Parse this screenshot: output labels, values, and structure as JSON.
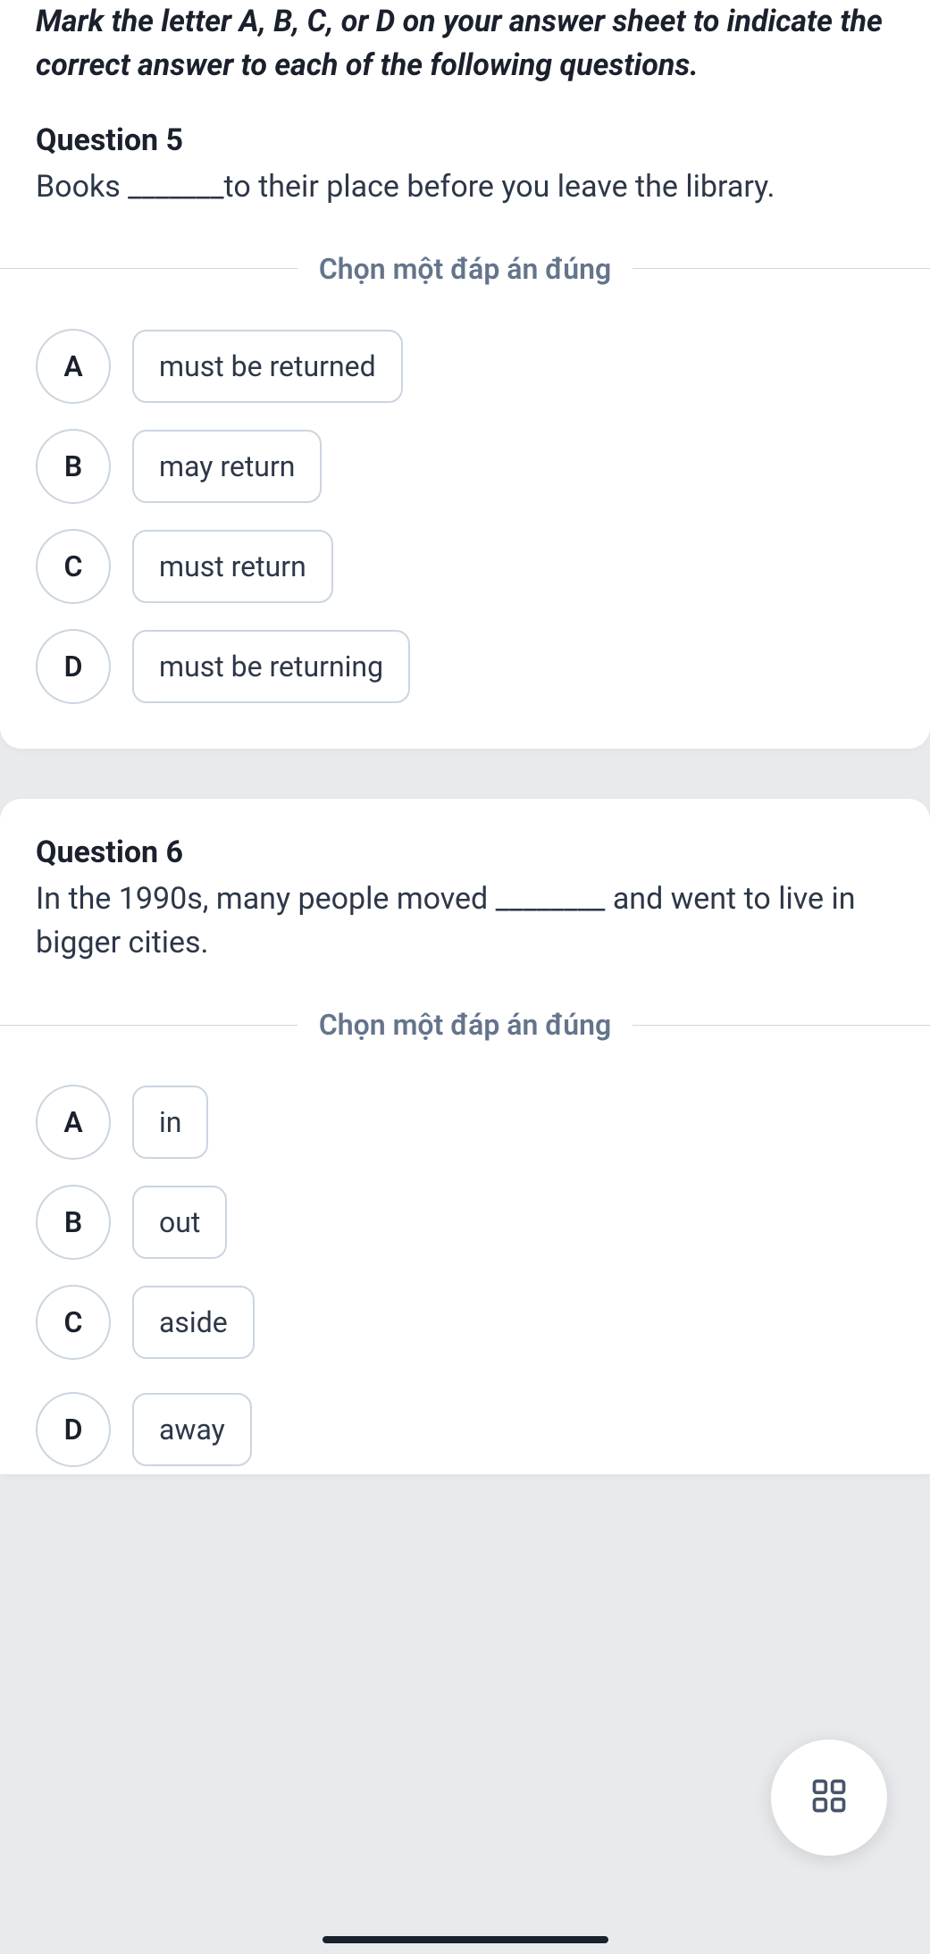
{
  "instructions": "Mark the letter A, B, C, or D on your answer sheet to indicate the correct answer to each of the following questions.",
  "divider_label": "Chọn một đáp án đúng",
  "q5": {
    "title": "Question 5",
    "text": "Books _______to their place before you leave the library.",
    "options": [
      {
        "letter": "A",
        "text": "must be returned"
      },
      {
        "letter": "B",
        "text": "may return"
      },
      {
        "letter": "C",
        "text": "must return"
      },
      {
        "letter": "D",
        "text": "must be returning"
      }
    ]
  },
  "q6": {
    "title": "Question 6",
    "text": "In the 1990s, many people moved ________ and went to live in bigger cities.",
    "options": [
      {
        "letter": "A",
        "text": "in"
      },
      {
        "letter": "B",
        "text": "out"
      },
      {
        "letter": "C",
        "text": "aside"
      },
      {
        "letter": "D",
        "text": "away"
      }
    ]
  }
}
